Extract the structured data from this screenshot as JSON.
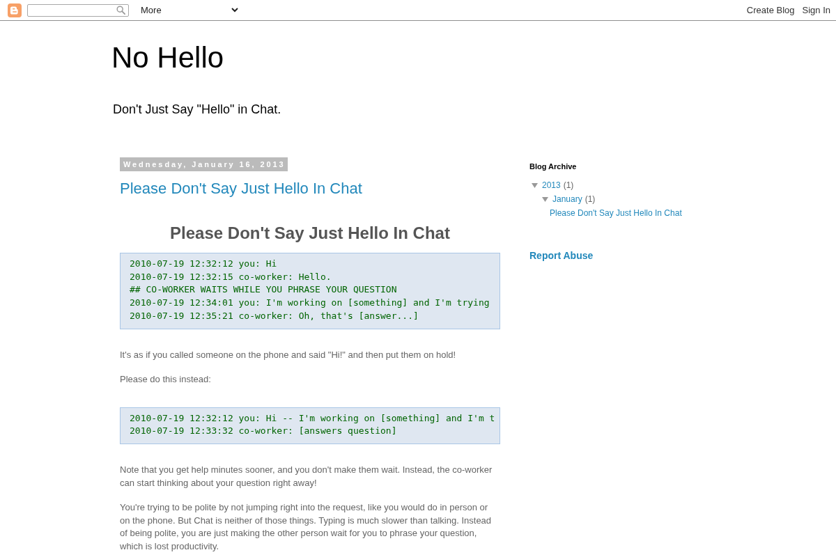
{
  "navbar": {
    "more_menu": "More",
    "links": [
      "Create Blog",
      "Sign In"
    ]
  },
  "header": {
    "title": "No Hello",
    "description": "Don't Just Say \"Hello\" in Chat."
  },
  "post": {
    "date": "Wednesday, January 16, 2013",
    "title": "Please Don't Say Just Hello In Chat",
    "body": [
      {
        "kind": "heading",
        "text": "Please Don't Say Just Hello In Chat"
      },
      {
        "kind": "code",
        "lines": [
          "2010-07-19 12:32:12 you: Hi",
          "2010-07-19 12:32:15 co-worker: Hello.",
          "## CO-WORKER WAITS WHILE YOU PHRASE YOUR QUESTION",
          "2010-07-19 12:34:01 you: I'm working on [something] and I'm trying",
          "2010-07-19 12:35:21 co-worker: Oh, that's [answer...]"
        ]
      },
      {
        "kind": "paragraph",
        "text": "It's as if you called someone on the phone and said \"Hi!\" and then put them on hold!"
      },
      {
        "kind": "paragraph",
        "text": "Please do this instead:"
      },
      {
        "kind": "code",
        "lines": [
          "2010-07-19 12:32:12 you: Hi -- I'm working on [something] and I'm t",
          "2010-07-19 12:33:32 co-worker: [answers question]"
        ]
      },
      {
        "kind": "paragraph",
        "text": "Note that you get help minutes sooner, and you don't make them wait. Instead, the co-worker can start thinking about your question right away!"
      },
      {
        "kind": "paragraph",
        "text": "You're trying to be polite by not jumping right into the request, like you would do in person or on the phone. But Chat is neither of those things. Typing is much slower than talking. Instead of being polite, you are just making the other person wait for you to phrase your question, which is lost productivity."
      }
    ]
  },
  "sidebar": {
    "archive": {
      "title": "Blog Archive",
      "tree": [
        {
          "label": "2013",
          "count": "(1)",
          "expanded": true,
          "children": [
            {
              "label": "January",
              "count": "(1)",
              "expanded": true,
              "children": [
                {
                  "label": "Please Don't Say Just Hello In Chat"
                }
              ]
            }
          ]
        }
      ]
    },
    "report_abuse": "Report Abuse"
  }
}
